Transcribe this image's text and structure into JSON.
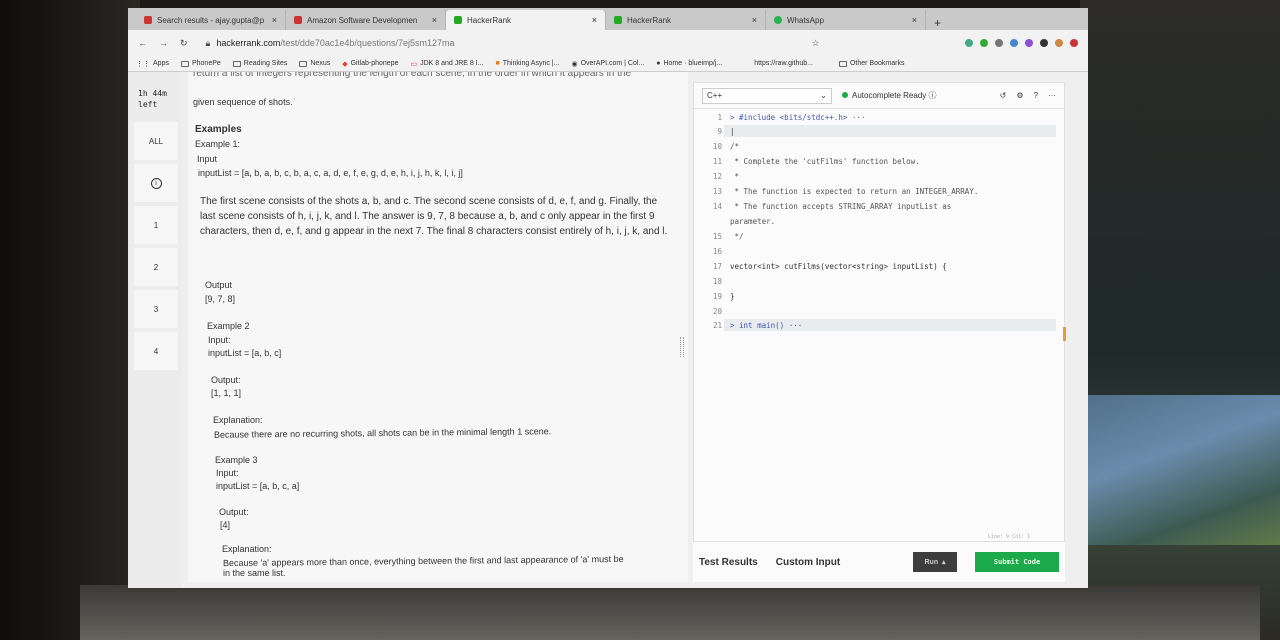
{
  "tabs": [
    {
      "label": "Search results - ajay.gupta@p",
      "icon": "mail-icon",
      "active": false
    },
    {
      "label": "Amazon Software Developmen",
      "icon": "mail-icon",
      "active": false
    },
    {
      "label": "HackerRank",
      "icon": "hackerrank-icon",
      "active": true
    },
    {
      "label": "HackerRank",
      "icon": "hackerrank-icon",
      "active": false
    },
    {
      "label": "WhatsApp",
      "icon": "whatsapp-icon",
      "active": false
    }
  ],
  "toolbar": {
    "host": "hackerrank.com",
    "path": "/test/dde70ac1e4b/questions/7ej5sm127ma"
  },
  "bookmarks": [
    "Apps",
    "PhonePe",
    "Reading Sites",
    "Nexus",
    "Gitlab-phonepe",
    "JDK 8 and JRE 8 I...",
    "Thinking Async |...",
    "OverAPI.com | Col...",
    "Home · blueimp/j...",
    "https://raw.github...",
    "Other Bookmarks"
  ],
  "sidebar": {
    "timer_line1": "1h 44m",
    "timer_line2": "left",
    "items": [
      "ALL",
      "",
      "1",
      "2",
      "3",
      "4"
    ]
  },
  "problem": {
    "cut_line": "return a list of integers representing the length of each scene, in the order in which it appears in the",
    "intro_line": "given sequence of shots.",
    "examples_heading": "Examples",
    "ex1_title": "Example 1:",
    "ex1_input_label": "Input",
    "ex1_input": "inputList = [a, b, a, b, c, b, a, c, a, d, e, f, e, g, d, e, h, i, j, h, k, l, i, j]",
    "ex1_desc": "The first scene consists of the shots a, b, and c. The second scene consists of d, e, f, and g. Finally, the last scene consists of h, i, j, k, and l. The answer is 9, 7, 8 because a, b, and c only appear in the first 9 characters, then d, e, f, and g appear in the next 7. The final 8 characters consist entirely of h, i, j, k, and l.",
    "ex1_output_label": "Output",
    "ex1_output": "[9, 7, 8]",
    "ex2_title": "Example 2",
    "ex2_input_label": "Input:",
    "ex2_input": "inputList = [a, b, c]",
    "ex2_output_label": "Output:",
    "ex2_output": "[1, 1, 1]",
    "ex2_expl_label": "Explanation:",
    "ex2_expl": "Because there are no recurring shots, all shots can be in the minimal length 1 scene.",
    "ex3_title": "Example 3",
    "ex3_input_label": "Input:",
    "ex3_input": "inputList = [a, b, c, a]",
    "ex3_output_label": "Output:",
    "ex3_output": "[4]",
    "ex3_expl_label": "Explanation:",
    "ex3_expl_1": "Because 'a' appears more than once, everything between the first and last appearance of 'a' must be",
    "ex3_expl_2": "in the same list."
  },
  "editor": {
    "language": "C++",
    "status": "Autocomplete Ready",
    "lines": [
      {
        "n": "1",
        "text": "> #include <bits/stdc++.h> ···"
      },
      {
        "n": "9",
        "text": "|"
      },
      {
        "n": "10",
        "text": "/*"
      },
      {
        "n": "11",
        "text": " * Complete the 'cutFilms' function below."
      },
      {
        "n": "12",
        "text": " *"
      },
      {
        "n": "13",
        "text": " * The function is expected to return an INTEGER_ARRAY."
      },
      {
        "n": "14",
        "text": " * The function accepts STRING_ARRAY inputList as"
      },
      {
        "n": "",
        "text": "parameter."
      },
      {
        "n": "15",
        "text": " */"
      },
      {
        "n": "16",
        "text": ""
      },
      {
        "n": "17",
        "text": "vector<int> cutFilms(vector<string> inputList) {"
      },
      {
        "n": "18",
        "text": ""
      },
      {
        "n": "19",
        "text": "}"
      },
      {
        "n": "20",
        "text": ""
      },
      {
        "n": "21",
        "text": "> int main() ···"
      }
    ],
    "linecol": "Line: 9 Col: 1",
    "test_results": "Test Results",
    "custom_input": "Custom Input",
    "run": "Run",
    "submit": "Submit Code"
  },
  "colors": {
    "accent": "#1ba94c",
    "run": "#3d3d3d"
  }
}
